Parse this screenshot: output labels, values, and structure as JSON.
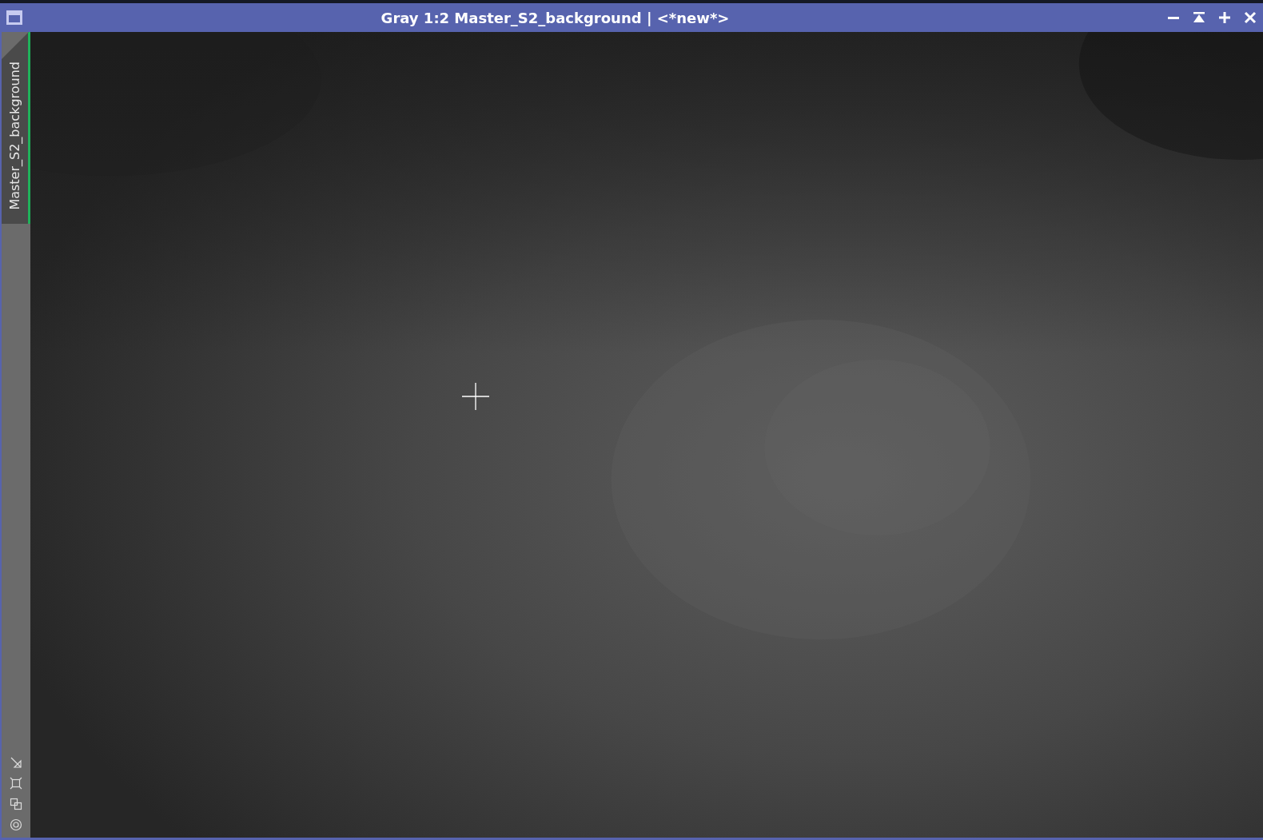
{
  "window": {
    "title": "Gray 1:2 Master_S2_background | <*new*>"
  },
  "tabs": [
    {
      "label": "Master_S2_background",
      "selected": true
    }
  ]
}
